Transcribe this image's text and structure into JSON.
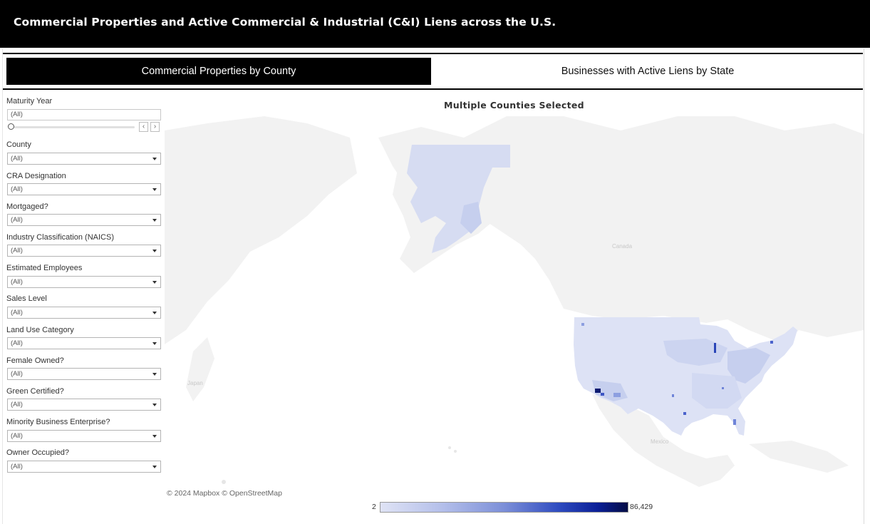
{
  "header": {
    "title": "Commercial Properties and Active Commercial & Industrial (C&I) Liens across the U.S."
  },
  "tabs": [
    {
      "label": "Commercial Properties by County",
      "active": true
    },
    {
      "label": "Businesses with Active Liens by State",
      "active": false
    }
  ],
  "filters": {
    "maturity_year": {
      "label": "Maturity Year",
      "value": "(All)"
    },
    "dropdowns": [
      {
        "label": "County",
        "value": "(All)"
      },
      {
        "label": "CRA Designation",
        "value": "(All)"
      },
      {
        "label": "Mortgaged?",
        "value": "(All)"
      },
      {
        "label": "Industry Classification (NAICS)",
        "value": "(All)"
      },
      {
        "label": "Estimated Employees",
        "value": "(All)"
      },
      {
        "label": "Sales Level",
        "value": "(All)"
      },
      {
        "label": "Land Use Category",
        "value": "(All)"
      },
      {
        "label": "Female Owned?",
        "value": "(All)"
      },
      {
        "label": "Green Certified?",
        "value": "(All)"
      },
      {
        "label": "Minority Business Enterprise?",
        "value": "(All)"
      },
      {
        "label": "Owner Occupied?",
        "value": "(All)"
      }
    ]
  },
  "map": {
    "title": "Multiple Counties Selected",
    "attribution": "© 2024 Mapbox  © OpenStreetMap",
    "labels": {
      "canada": "Canada",
      "japan": "Japan",
      "mexico": "Mexico"
    },
    "legend": {
      "min": "2",
      "max": "86,429"
    },
    "colors": {
      "low": "#dfe3f5",
      "mid": "#7c8fd8",
      "high": "#050d45",
      "land": "#f2f2f2"
    }
  }
}
